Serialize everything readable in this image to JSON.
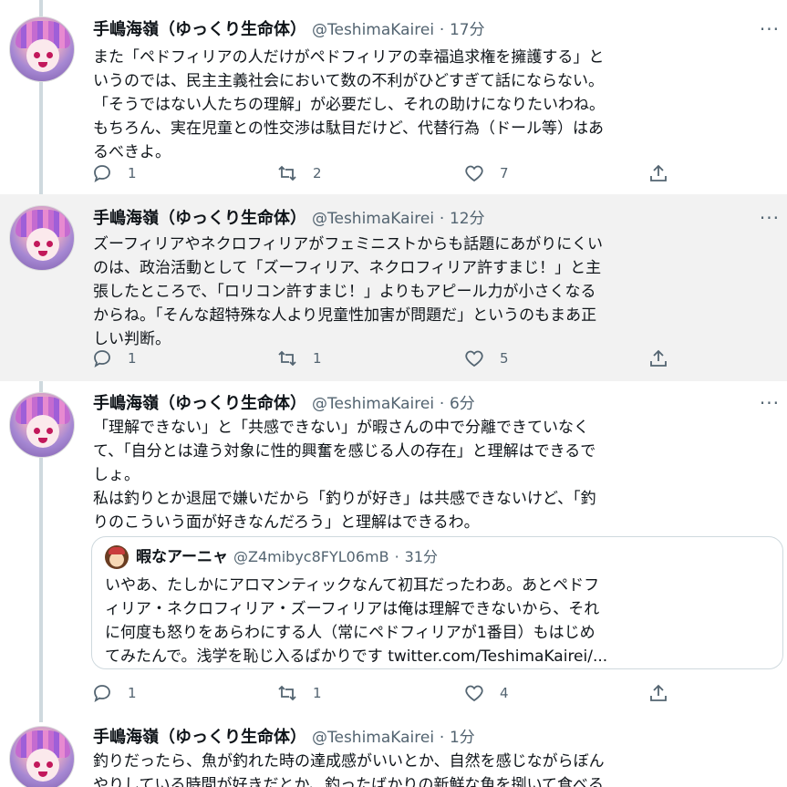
{
  "tweets": [
    {
      "name": "手嶋海嶺（ゆっくり生命体）",
      "handle": "@TeshimaKairei",
      "dot": "·",
      "time": "17分",
      "text": "また「ペドフィリアの人だけがペドフィリアの幸福追求権を擁護する」と\nいうのでは、民主主義社会において数の不利がひどすぎて話にならない。\n「そうではない人たちの理解」が必要だし、それの助けになりたいわね。\nもちろん、実在児童との性交渉は駄目だけど、代替行為（ドール等）はあ\nるべきよ。",
      "replies": "1",
      "retweets": "2",
      "likes": "7"
    },
    {
      "name": "手嶋海嶺（ゆっくり生命体）",
      "handle": "@TeshimaKairei",
      "dot": "·",
      "time": "12分",
      "text": "ズーフィリアやネクロフィリアがフェミニストからも話題にあがりにくい\nのは、政治活動として「ズーフィリア、ネクロフィリア許すまじ！」と主\n張したところで、「ロリコン許すまじ！」よりもアピール力が小さくなる\nからね。「そんな超特殊な人より児童性加害が問題だ」というのもまあ正\nしい判断。",
      "replies": "1",
      "retweets": "1",
      "likes": "5"
    },
    {
      "name": "手嶋海嶺（ゆっくり生命体）",
      "handle": "@TeshimaKairei",
      "dot": "·",
      "time": "6分",
      "text": "「理解できない」と「共感できない」が暇さんの中で分離できていなく\nて、「自分とは違う対象に性的興奮を感じる人の存在」と理解はできるで\nしょ。\n私は釣りとか退屈で嫌いだから「釣りが好き」は共感できないけど、「釣\nりのこういう面が好きなんだろう」と理解はできるわ。",
      "replies": "1",
      "retweets": "1",
      "likes": "4",
      "quote": {
        "name": "暇なアーニャ",
        "handle": "@Z4mibyc8FYL06mB",
        "dot": "·",
        "time": "31分",
        "text": "いやあ、たしかにアロマンティックなんて初耳だったわあ。あとペドフ\nィリア・ネクロフィリア・ズーフィリアは俺は理解できないから、それ\nに何度も怒りをあらわにする人（常にペドフィリアが1番目）もはじめ\nてみたんで。浅学を恥じ入るばかりです twitter.com/TeshimaKairei/..."
      }
    },
    {
      "name": "手嶋海嶺（ゆっくり生命体）",
      "handle": "@TeshimaKairei",
      "dot": "·",
      "time": "1分",
      "text": "釣りだったら、魚が釣れた時の達成感がいいとか、自然を感じながらぼん\nやりしている時間が好きだとか、釣ったばかりの新鮮な魚を捌いて食べる"
    }
  ],
  "more_label": "···"
}
